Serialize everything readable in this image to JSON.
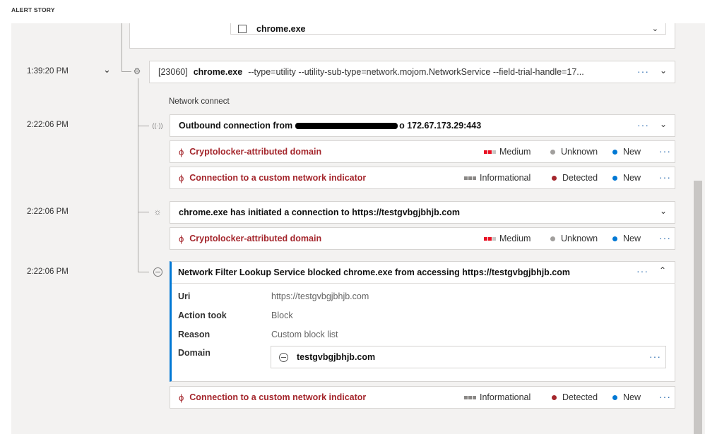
{
  "header": {
    "title": "ALERT STORY"
  },
  "top_card": {
    "label": "chrome.exe"
  },
  "process": {
    "time": "1:39:20 PM",
    "pid": "[23060]",
    "name": "chrome.exe",
    "args": "--type=utility --utility-sub-type=network.mojom.NetworkService --field-trial-handle=17...",
    "more": "···"
  },
  "network_label": "Network connect",
  "events": [
    {
      "time": "2:22:06 PM",
      "title_prefix": "Outbound connection from",
      "title_suffix": "o 172.67.173.29:443",
      "icon": "broadcast-icon",
      "alerts": [
        {
          "title": "Cryptolocker-attributed domain",
          "severity": "Medium",
          "determination": "Unknown",
          "status": "New"
        },
        {
          "title": "Connection to a custom network indicator",
          "severity": "Informational",
          "determination": "Detected",
          "status": "New"
        }
      ]
    },
    {
      "time": "2:22:06 PM",
      "title": "chrome.exe has initiated a connection to https://testgvbgjbhjb.com",
      "icon": "plug-icon",
      "alerts": [
        {
          "title": "Cryptolocker-attributed domain",
          "severity": "Medium",
          "determination": "Unknown",
          "status": "New"
        }
      ]
    },
    {
      "time": "2:22:06 PM",
      "title": "Network Filter Lookup Service blocked chrome.exe from accessing https://testgvbgjbhjb.com",
      "icon": "blocked-icon",
      "details": {
        "uri_key": "Uri",
        "uri_val": "https://testgvbgjbhjb.com",
        "action_key": "Action took",
        "action_val": "Block",
        "reason_key": "Reason",
        "reason_val": "Custom block list",
        "domain_key": "Domain",
        "domain_val": "testgvbgjbhjb.com"
      },
      "alerts": [
        {
          "title": "Connection to a custom network indicator",
          "severity": "Informational",
          "determination": "Detected",
          "status": "New"
        }
      ]
    }
  ],
  "colors": {
    "alert_red": "#a4262c",
    "link_blue": "#2b6cb0",
    "medium_red": "#e81123",
    "info_gray": "#8a8886",
    "detected_red": "#a4262c",
    "new_blue": "#0078d4",
    "unknown_gray": "#a19f9d"
  }
}
